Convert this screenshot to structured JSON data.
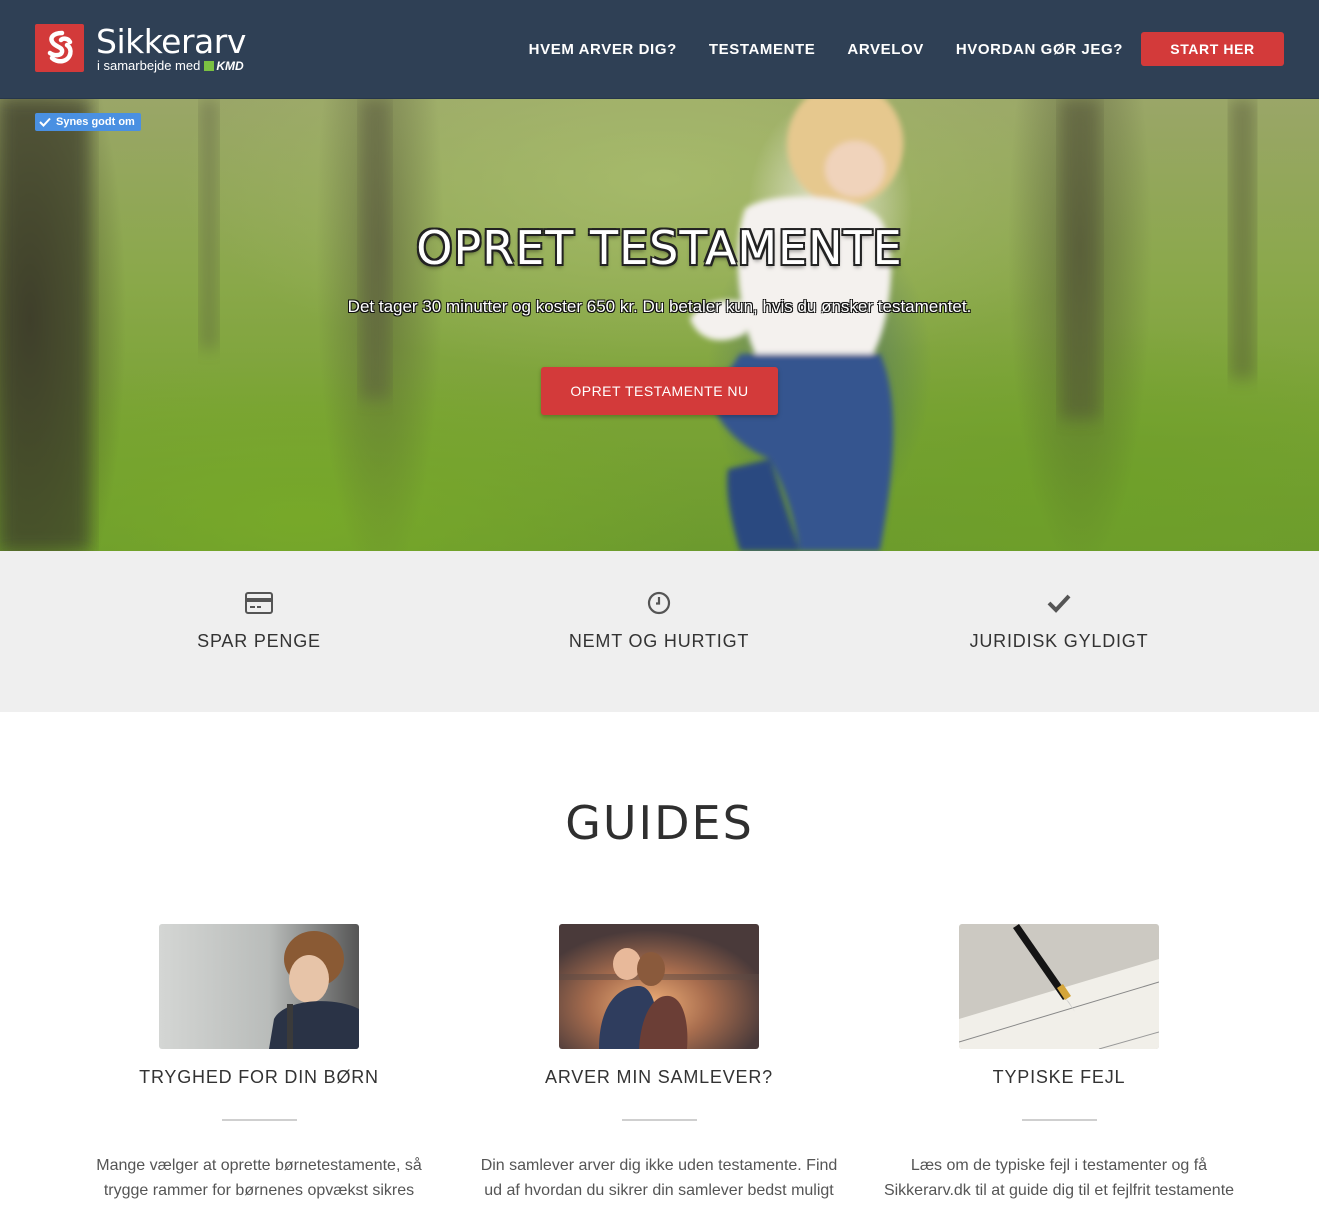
{
  "header": {
    "logo_name": "Sikkerarv",
    "logo_sub": "i samarbejde med",
    "logo_partner": "KMD",
    "nav": [
      {
        "label": "HVEM ARVER DIG?"
      },
      {
        "label": "TESTAMENTE"
      },
      {
        "label": "ARVELOV"
      },
      {
        "label": "HVORDAN GØR JEG?"
      }
    ],
    "cta_label": "START HER"
  },
  "hero": {
    "like_badge": "Synes godt om",
    "title": "OPRET TESTAMENTE",
    "subtitle": "Det tager 30 minutter og koster 650 kr. Du betaler kun, hvis du ønsker testamentet.",
    "button_label": "OPRET TESTAMENTE NU"
  },
  "features": [
    {
      "icon": "credit-card-icon",
      "label": "SPAR PENGE"
    },
    {
      "icon": "clock-icon",
      "label": "NEMT OG HURTIGT"
    },
    {
      "icon": "checkmark-icon",
      "label": "JURIDISK GYLDIGT"
    }
  ],
  "guides": {
    "title": "GUIDES",
    "items": [
      {
        "title": "TRYGHED FOR DIN BØRN",
        "text": "Mange vælger at oprette børnetestamente, så trygge rammer for børnenes opvækst sikres"
      },
      {
        "title": "ARVER MIN SAMLEVER?",
        "text": "Din samlever arver dig ikke uden testamente. Find ud af hvordan du sikrer din samlever bedst muligt"
      },
      {
        "title": "TYPISKE FEJL",
        "text": "Læs om de typiske fejl i testamenter og få Sikkerarv.dk til at guide dig til et fejlfrit testamente"
      }
    ]
  },
  "colors": {
    "header_bg": "#2f4055",
    "accent_red": "#d33a3a",
    "features_bg": "#efefef",
    "kmd_green": "#7bc142"
  }
}
